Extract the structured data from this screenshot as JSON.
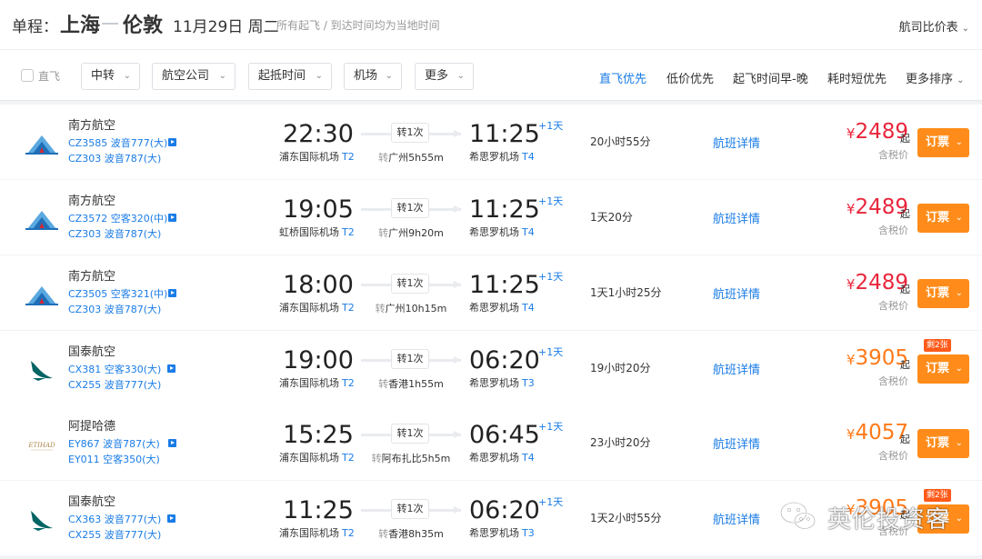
{
  "header": {
    "trip_type": "单程：",
    "from": "上海",
    "to": "伦敦",
    "date": "11月29日 周二",
    "note": "所有起飞 / 到达时间均为当地时间",
    "price_table": "航司比价表"
  },
  "filters": {
    "direct_label": "直飞",
    "buttons": [
      "中转",
      "航空公司",
      "起抵时间",
      "机场",
      "更多"
    ],
    "sorts": [
      "直飞优先",
      "低价优先",
      "起飞时间早-晚",
      "耗时短优先",
      "更多排序"
    ],
    "active_sort": "直飞优先"
  },
  "flights": [
    {
      "airline": "南方航空",
      "logo": "china-southern-logo",
      "leg1": "CZ3585 波音777(大)",
      "leg2": "CZ303 波音787(大)",
      "dep_time": "22:30",
      "dep_airport": "浦东国际机场",
      "dep_terminal": "T2",
      "stops": "转1次",
      "transit_prefix": "转",
      "transit": "广州5h55m",
      "arr_time": "11:25",
      "plus_day": "+1天",
      "arr_airport": "希思罗机场",
      "arr_terminal": "T4",
      "duration": "20小时55分",
      "detail": "航班详情",
      "currency": "¥",
      "price": "2489",
      "price_suffix": "起",
      "tax": "含税价",
      "book": "订票",
      "badge": ""
    },
    {
      "airline": "南方航空",
      "logo": "china-southern-logo",
      "leg1": "CZ3572 空客320(中)",
      "leg2": "CZ303 波音787(大)",
      "dep_time": "19:05",
      "dep_airport": "虹桥国际机场",
      "dep_terminal": "T2",
      "stops": "转1次",
      "transit_prefix": "转",
      "transit": "广州9h20m",
      "arr_time": "11:25",
      "plus_day": "+1天",
      "arr_airport": "希思罗机场",
      "arr_terminal": "T4",
      "duration": "1天20分",
      "detail": "航班详情",
      "currency": "¥",
      "price": "2489",
      "price_suffix": "起",
      "tax": "含税价",
      "book": "订票",
      "badge": ""
    },
    {
      "airline": "南方航空",
      "logo": "china-southern-logo",
      "leg1": "CZ3505 空客321(中)",
      "leg2": "CZ303 波音787(大)",
      "dep_time": "18:00",
      "dep_airport": "浦东国际机场",
      "dep_terminal": "T2",
      "stops": "转1次",
      "transit_prefix": "转",
      "transit": "广州10h15m",
      "arr_time": "11:25",
      "plus_day": "+1天",
      "arr_airport": "希思罗机场",
      "arr_terminal": "T4",
      "duration": "1天1小时25分",
      "detail": "航班详情",
      "currency": "¥",
      "price": "2489",
      "price_suffix": "起",
      "tax": "含税价",
      "book": "订票",
      "badge": ""
    },
    {
      "airline": "国泰航空",
      "logo": "cathay-pacific-logo",
      "leg1": "CX381 空客330(大)",
      "leg2": "CX255 波音777(大)",
      "dep_time": "19:00",
      "dep_airport": "浦东国际机场",
      "dep_terminal": "T2",
      "stops": "转1次",
      "transit_prefix": "转",
      "transit": "香港1h55m",
      "arr_time": "06:20",
      "plus_day": "+1天",
      "arr_airport": "希思罗机场",
      "arr_terminal": "T3",
      "duration": "19小时20分",
      "detail": "航班详情",
      "currency": "¥",
      "price": "3905",
      "price_suffix": "起",
      "tax": "含税价",
      "book": "订票",
      "badge": "剩2张"
    },
    {
      "airline": "阿提哈德",
      "logo": "etihad-logo",
      "leg1": "EY867 波音787(大)",
      "leg2": "EY011 空客350(大)",
      "dep_time": "15:25",
      "dep_airport": "浦东国际机场",
      "dep_terminal": "T2",
      "stops": "转1次",
      "transit_prefix": "转",
      "transit": "阿布扎比5h5m",
      "arr_time": "06:45",
      "plus_day": "+1天",
      "arr_airport": "希思罗机场",
      "arr_terminal": "T4",
      "duration": "23小时20分",
      "detail": "航班详情",
      "currency": "¥",
      "price": "4057",
      "price_suffix": "起",
      "tax": "含税价",
      "book": "订票",
      "badge": ""
    },
    {
      "airline": "国泰航空",
      "logo": "cathay-pacific-logo",
      "leg1": "CX363 波音777(大)",
      "leg2": "CX255 波音777(大)",
      "dep_time": "11:25",
      "dep_airport": "浦东国际机场",
      "dep_terminal": "T2",
      "stops": "转1次",
      "transit_prefix": "转",
      "transit": "香港8h35m",
      "arr_time": "06:20",
      "plus_day": "+1天",
      "arr_airport": "希思罗机场",
      "arr_terminal": "T3",
      "duration": "1天2小时55分",
      "detail": "航班详情",
      "currency": "¥",
      "price": "3905",
      "price_suffix": "起",
      "tax": "含税价",
      "book": "订票",
      "badge": "剩2张"
    }
  ],
  "watermark": "英伦投资客",
  "colors": {
    "link_blue": "#1a7ce6",
    "price_red": "#e8263c",
    "price_orange": "#ff7a1a",
    "book_orange": "#ff8c1a"
  }
}
